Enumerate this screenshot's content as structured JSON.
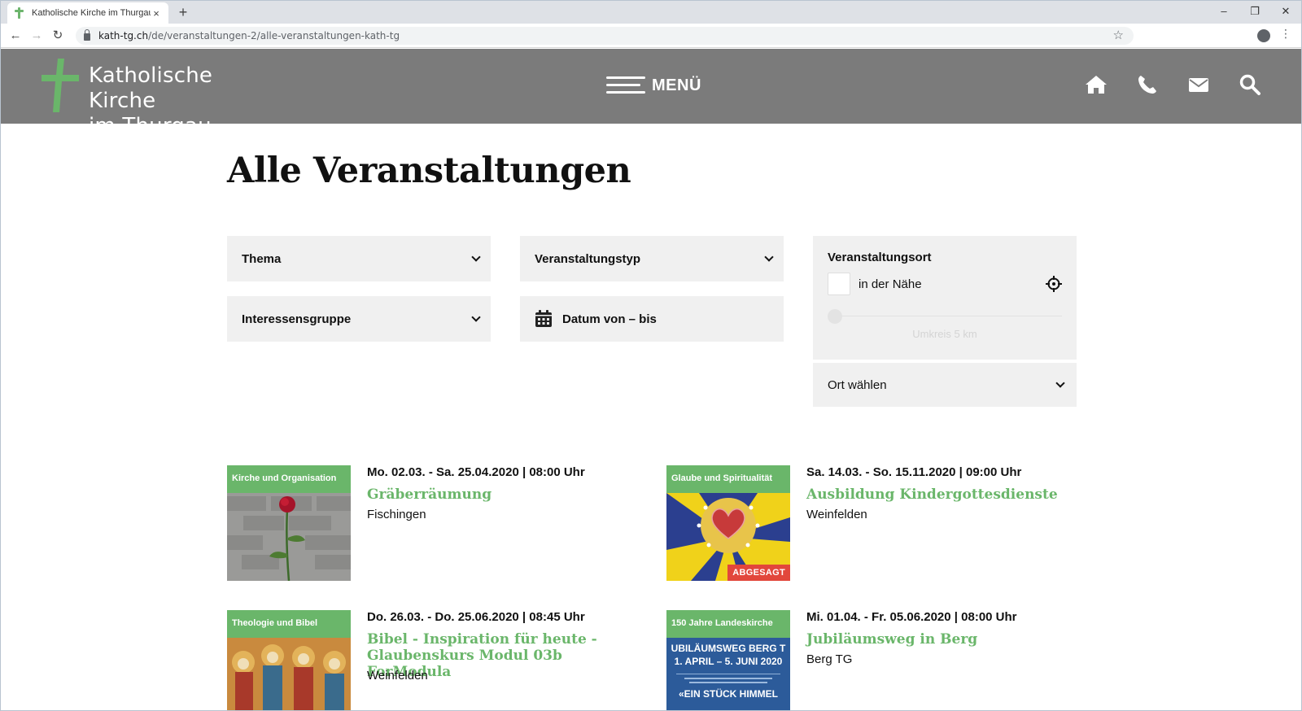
{
  "browser": {
    "tab_title": "Katholische Kirche im Thurgau",
    "tab_close": "×",
    "new_tab": "+",
    "url_host": "kath-tg.ch",
    "url_path": "/de/veranstaltungen-2/alle-veranstaltungen-kath-tg",
    "window_controls": [
      "–",
      "❐",
      "✕"
    ]
  },
  "header": {
    "logo_line1": "Katholische Kirche",
    "logo_line2": "im Thurgau",
    "menu_label": "MENÜ",
    "icons": [
      "home-icon",
      "phone-icon",
      "mail-icon",
      "search-icon"
    ]
  },
  "page": {
    "title": "Alle Veranstaltungen"
  },
  "filters": {
    "thema": "Thema",
    "veranstaltungstyp": "Veranstaltungstyp",
    "interessensgruppe": "Interessensgruppe",
    "datum": "Datum von – bis",
    "ort_title": "Veranstaltungsort",
    "nearby_label": "in der Nähe",
    "radius_label": "Umkreis 5 km",
    "ort_select": "Ort wählen"
  },
  "events": [
    {
      "category": "Kirche und Organisation",
      "date": "Mo. 02.03. - Sa. 25.04.2020 | 08:00 Uhr",
      "title": "Gräberräumung",
      "place": "Fischingen",
      "badge": ""
    },
    {
      "category": "Glaube und Spiritualität",
      "date": "Sa. 14.03. - So. 15.11.2020 | 09:00 Uhr",
      "title": "Ausbildung Kindergottesdienste",
      "place": "Weinfelden",
      "badge": "ABGESAGT"
    },
    {
      "category": "Theologie und Bibel",
      "date": "Do. 26.03. - Do. 25.06.2020 | 08:45 Uhr",
      "title": "Bibel - Inspiration für heute - Glaubenskurs Modul 03b ForModula",
      "place": "Weinfelden",
      "badge": ""
    },
    {
      "category": "150 Jahre Landeskirche",
      "date": "Mi. 01.04. - Fr. 05.06.2020 | 08:00 Uhr",
      "title": "Jubiläumsweg in Berg",
      "place": "Berg TG",
      "badge": "",
      "image_text": [
        "UBILÄUMSWEG BERG T",
        "1. APRIL – 5. JUNI 2020",
        "«EIN STÜCK HIMMEL"
      ]
    }
  ],
  "colors": {
    "header_bg": "#7b7b7b",
    "accent_green": "#6ab66a",
    "badge_red": "#e2473c",
    "filter_bg": "#f0f0f0"
  }
}
